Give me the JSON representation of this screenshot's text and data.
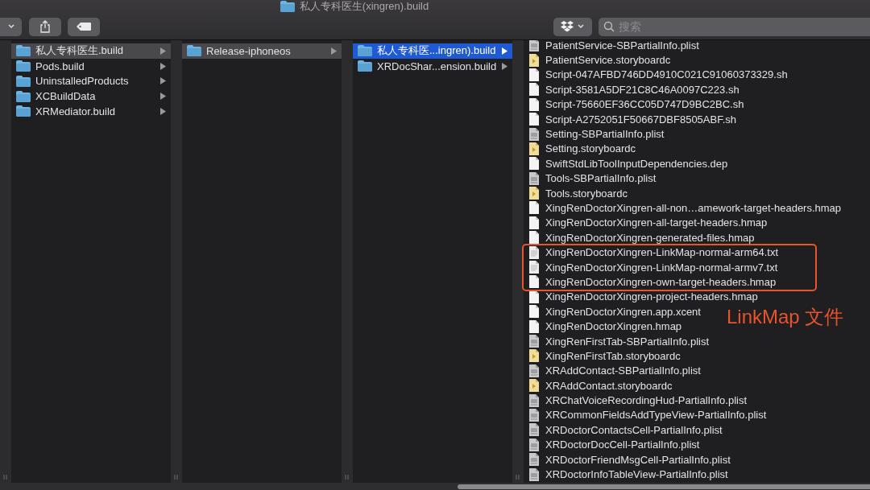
{
  "window": {
    "title": "私人专科医生(xingren).build"
  },
  "toolbar": {
    "search": {
      "placeholder": "搜索"
    }
  },
  "columns": [
    {
      "items": [
        {
          "name": "私人专科医生.build",
          "selected": true
        },
        {
          "name": "Pods.build",
          "selected": false
        },
        {
          "name": "UninstalledProducts",
          "selected": false
        },
        {
          "name": "XCBuildData",
          "selected": false
        },
        {
          "name": "XRMediator.build",
          "selected": false
        }
      ]
    },
    {
      "items": [
        {
          "name": "Release-iphoneos",
          "selected": true
        }
      ]
    },
    {
      "items": [
        {
          "name": "私人专科医...ingren).build",
          "selected": true
        },
        {
          "name": "XRDocShar...ension.build",
          "selected": false
        }
      ]
    }
  ],
  "files": [
    {
      "name": "PatientService-SBPartialInfo.plist",
      "kind": "plist"
    },
    {
      "name": "PatientService.storyboardc",
      "kind": "storyboard"
    },
    {
      "name": "Script-047AFBD746DD4910C021C91060373329.sh",
      "kind": "doc"
    },
    {
      "name": "Script-3581A5DF21C8C46A0097C223.sh",
      "kind": "doc"
    },
    {
      "name": "Script-75660EF36CC05D747D9BC2BC.sh",
      "kind": "doc"
    },
    {
      "name": "Script-A2752051F50667DBF8505ABF.sh",
      "kind": "doc"
    },
    {
      "name": "Setting-SBPartialInfo.plist",
      "kind": "plist"
    },
    {
      "name": "Setting.storyboardc",
      "kind": "storyboard"
    },
    {
      "name": "SwiftStdLibToolInputDependencies.dep",
      "kind": "doc"
    },
    {
      "name": "Tools-SBPartialInfo.plist",
      "kind": "plist"
    },
    {
      "name": "Tools.storyboardc",
      "kind": "storyboard"
    },
    {
      "name": "XingRenDoctorXingren-all-non…amework-target-headers.hmap",
      "kind": "doc"
    },
    {
      "name": "XingRenDoctorXingren-all-target-headers.hmap",
      "kind": "doc"
    },
    {
      "name": "XingRenDoctorXingren-generated-files.hmap",
      "kind": "doc"
    },
    {
      "name": "XingRenDoctorXingren-LinkMap-normal-arm64.txt",
      "kind": "text"
    },
    {
      "name": "XingRenDoctorXingren-LinkMap-normal-armv7.txt",
      "kind": "text"
    },
    {
      "name": "XingRenDoctorXingren-own-target-headers.hmap",
      "kind": "doc"
    },
    {
      "name": "XingRenDoctorXingren-project-headers.hmap",
      "kind": "doc"
    },
    {
      "name": "XingRenDoctorXingren.app.xcent",
      "kind": "doc"
    },
    {
      "name": "XingRenDoctorXingren.hmap",
      "kind": "doc"
    },
    {
      "name": "XingRenFirstTab-SBPartialInfo.plist",
      "kind": "plist"
    },
    {
      "name": "XingRenFirstTab.storyboardc",
      "kind": "storyboard"
    },
    {
      "name": "XRAddContact-SBPartialInfo.plist",
      "kind": "plist"
    },
    {
      "name": "XRAddContact.storyboardc",
      "kind": "storyboard"
    },
    {
      "name": "XRChatVoiceRecordingHud-PartialInfo.plist",
      "kind": "plist"
    },
    {
      "name": "XRCommonFieldsAddTypeView-PartialInfo.plist",
      "kind": "plist"
    },
    {
      "name": "XRDoctorContactsCell-PartialInfo.plist",
      "kind": "plist"
    },
    {
      "name": "XRDoctorDocCell-PartialInfo.plist",
      "kind": "plist"
    },
    {
      "name": "XRDoctorFriendMsgCell-PartialInfo.plist",
      "kind": "plist"
    },
    {
      "name": "XRDoctorInfoTableView-PartialInfo.plist",
      "kind": "plist"
    }
  ],
  "annotation": {
    "label": "LinkMap 文件"
  }
}
